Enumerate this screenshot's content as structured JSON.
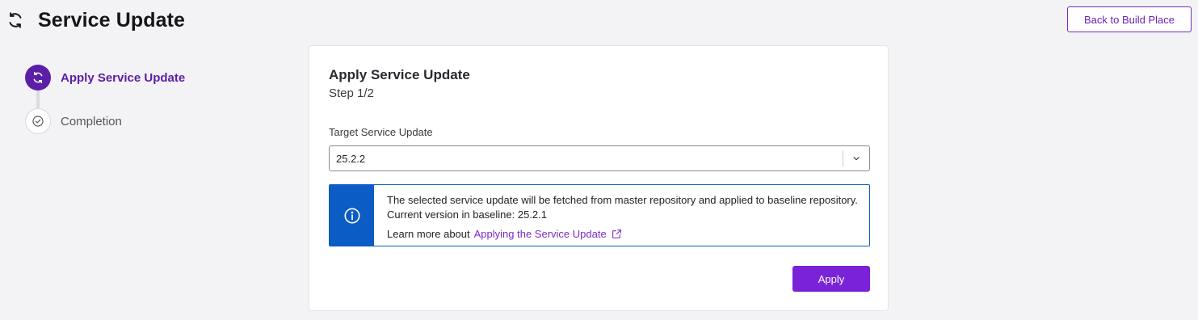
{
  "header": {
    "title": "Service Update",
    "title_icon": "sync-icon",
    "back_button_label": "Back to Build Place"
  },
  "stepper": {
    "steps": [
      {
        "label": "Apply Service Update",
        "state": "active",
        "icon": "sync-icon"
      },
      {
        "label": "Completion",
        "state": "pending",
        "icon": "check-circle-icon"
      }
    ]
  },
  "card": {
    "title": "Apply Service Update",
    "subtitle": "Step 1/2",
    "target_field": {
      "label": "Target Service Update",
      "value": "25.2.2"
    },
    "info": {
      "line1": "The selected service update will be fetched from master repository and applied to baseline repository.",
      "line2": "Current version in baseline: 25.2.1",
      "learn_prefix": "Learn more about",
      "learn_link": "Applying the Service Update"
    },
    "apply_label": "Apply"
  },
  "colors": {
    "accent": "#7a22d8",
    "active_step": "#5b1ea6",
    "info_blue": "#0b5cc4",
    "background": "#f3f2f5"
  }
}
